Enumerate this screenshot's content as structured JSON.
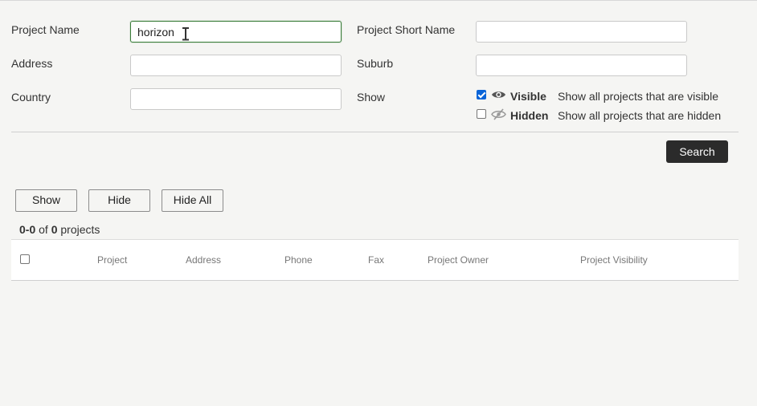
{
  "filters": {
    "project_name": {
      "label": "Project Name",
      "value": "horizon",
      "placeholder": ""
    },
    "project_short_name": {
      "label": "Project Short Name",
      "value": "",
      "placeholder": ""
    },
    "address": {
      "label": "Address",
      "value": "",
      "placeholder": ""
    },
    "suburb": {
      "label": "Suburb",
      "value": "",
      "placeholder": ""
    },
    "country": {
      "label": "Country",
      "value": "",
      "placeholder": ""
    },
    "show": {
      "label": "Show",
      "options": [
        {
          "label": "Visible",
          "description": "Show all projects that are visible",
          "checked": true,
          "icon": "eye-icon"
        },
        {
          "label": "Hidden",
          "description": "Show all projects that are hidden",
          "checked": false,
          "icon": "eye-slash-icon"
        }
      ]
    }
  },
  "actions": {
    "search_label": "Search",
    "show_label": "Show",
    "hide_label": "Hide",
    "hide_all_label": "Hide All"
  },
  "results": {
    "range": "0-0",
    "of_text": "of",
    "total": "0",
    "unit": "projects"
  },
  "table": {
    "columns": [
      "Project",
      "Address",
      "Phone",
      "Fax",
      "Project Owner",
      "Project Visibility"
    ]
  },
  "colors": {
    "focus_border": "#3a7d3a",
    "primary_button": "#2b2b2b",
    "checkbox_checked": "#0a64d8"
  }
}
